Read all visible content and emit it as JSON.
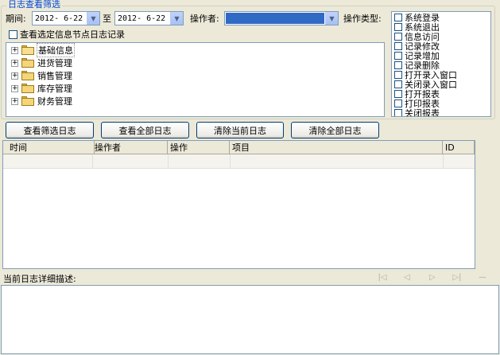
{
  "filter": {
    "group_title": "日志查看筛选",
    "period_label": "期间:",
    "date_from": "2012- 6-22",
    "to_label": "至",
    "date_to": "2012- 6-22",
    "operator_label": "操作者:",
    "operator_value": "",
    "op_type_label": "操作类型:",
    "node_checkbox_label": "查看选定信息节点日志记录"
  },
  "tree": {
    "items": [
      {
        "label": "基础信息",
        "selected": true
      },
      {
        "label": "进货管理",
        "selected": false
      },
      {
        "label": "销售管理",
        "selected": false
      },
      {
        "label": "库存管理",
        "selected": false
      },
      {
        "label": "财务管理",
        "selected": false
      }
    ]
  },
  "op_types": [
    "系统登录",
    "系统退出",
    "信息访问",
    "记录修改",
    "记录增加",
    "记录删除",
    "打开录入窗口",
    "关闭录入窗口",
    "打开报表",
    "打印报表",
    "关闭报表"
  ],
  "buttons": {
    "view_filtered": "查看筛选日志",
    "view_all": "查看全部日志",
    "clear_current": "清除当前日志",
    "clear_all": "清除全部日志"
  },
  "grid": {
    "columns": [
      "时间",
      "操作者",
      "操作",
      "项目",
      "ID"
    ]
  },
  "detail": {
    "label": "当前日志详细描述:"
  },
  "navigator": {
    "icons": [
      "first-icon",
      "prev-icon",
      "next-icon",
      "last-icon",
      "minus-icon"
    ],
    "glyphs": [
      "|◁",
      "◁",
      "▷",
      "▷|",
      "—"
    ]
  }
}
